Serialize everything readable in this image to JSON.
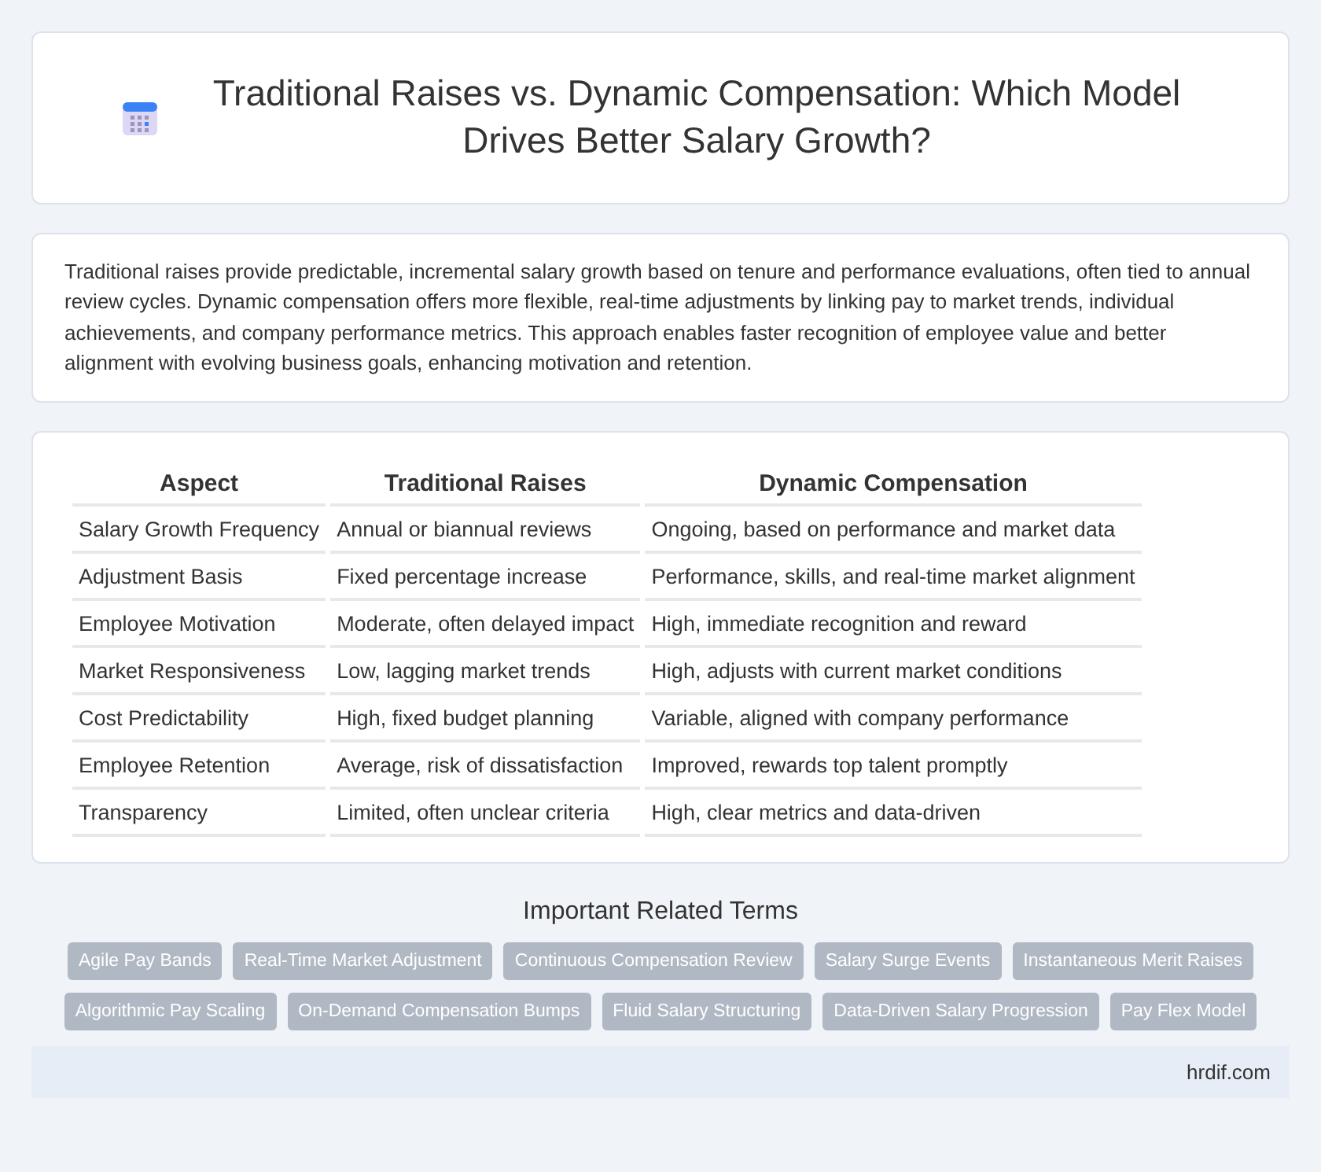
{
  "header": {
    "title": "Traditional Raises vs. Dynamic Compensation: Which Model Drives Better Salary Growth?"
  },
  "summary": "Traditional raises provide predictable, incremental salary growth based on tenure and performance evaluations, often tied to annual review cycles. Dynamic compensation offers more flexible, real-time adjustments by linking pay to market trends, individual achievements, and company performance metrics. This approach enables faster recognition of employee value and better alignment with evolving business goals, enhancing motivation and retention.",
  "table": {
    "columns": [
      "Aspect",
      "Traditional Raises",
      "Dynamic Compensation"
    ],
    "rows": [
      [
        "Salary Growth Frequency",
        "Annual or biannual reviews",
        "Ongoing, based on performance and market data"
      ],
      [
        "Adjustment Basis",
        "Fixed percentage increase",
        "Performance, skills, and real-time market alignment"
      ],
      [
        "Employee Motivation",
        "Moderate, often delayed impact",
        "High, immediate recognition and reward"
      ],
      [
        "Market Responsiveness",
        "Low, lagging market trends",
        "High, adjusts with current market conditions"
      ],
      [
        "Cost Predictability",
        "High, fixed budget planning",
        "Variable, aligned with company performance"
      ],
      [
        "Employee Retention",
        "Average, risk of dissatisfaction",
        "Improved, rewards top talent promptly"
      ],
      [
        "Transparency",
        "Limited, often unclear criteria",
        "High, clear metrics and data-driven"
      ]
    ]
  },
  "related": {
    "title": "Important Related Terms",
    "terms": [
      "Agile Pay Bands",
      "Real-Time Market Adjustment",
      "Continuous Compensation Review",
      "Salary Surge Events",
      "Instantaneous Merit Raises",
      "Algorithmic Pay Scaling",
      "On-Demand Compensation Bumps",
      "Fluid Salary Structuring",
      "Data-Driven Salary Progression",
      "Pay Flex Model"
    ]
  },
  "footer": {
    "site": "hrdif.com"
  }
}
